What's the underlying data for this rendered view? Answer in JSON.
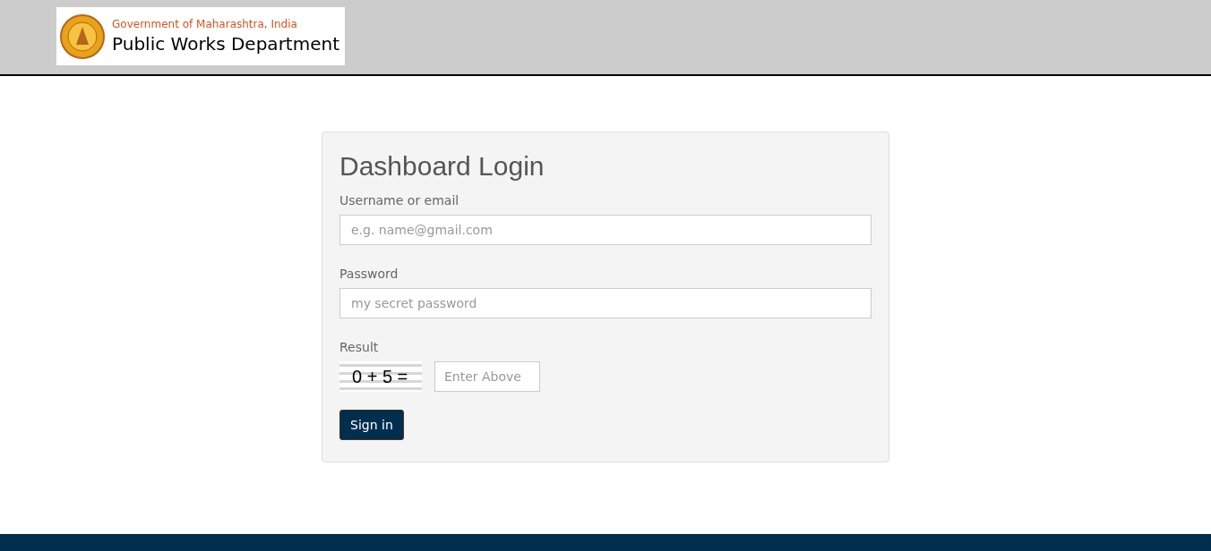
{
  "header": {
    "logo": {
      "subtitle": "Government of Maharashtra, India",
      "title": "Public Works Department"
    }
  },
  "login": {
    "title": "Dashboard Login",
    "fields": [
      {
        "label": "Username or email",
        "placeholder": "e.g. name@gmail.com"
      },
      {
        "label": "Password",
        "placeholder": "my secret password"
      }
    ],
    "captcha": {
      "label": "Result",
      "expression": "0 + 5 =",
      "placeholder": "Enter Above"
    },
    "button": "Sign in"
  }
}
